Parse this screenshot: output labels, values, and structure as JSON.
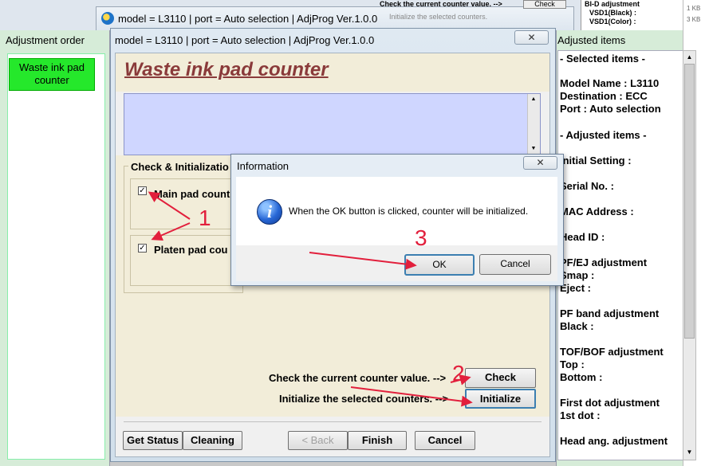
{
  "background": {
    "window_title": "model = L3110 | port = Auto selection | AdjProg Ver.1.0.0",
    "hint_check": "Check the current counter value. -->",
    "hint_init": "Initialize the selected counters.",
    "check_label": "Check",
    "right_panel_lines": [
      "BI-D adjustment",
      "VSD1(Black) :",
      "VSD1(Color) :"
    ],
    "file_sizes": [
      "1 KB",
      "3 KB"
    ]
  },
  "adjustment_order": {
    "title": "Adjustment order",
    "items": [
      {
        "label_line1": "Waste ink pad",
        "label_line2": "counter"
      }
    ]
  },
  "main_window": {
    "title": "model = L3110 | port = Auto selection | AdjProg Ver.1.0.0",
    "close_glyph": "✕",
    "page_title": "Waste ink pad counter",
    "group_label": "Check & Initializatio",
    "main_pad_label": "Main pad count",
    "platen_pad_label": "Platen pad cou",
    "main_pad_checked": true,
    "platen_pad_checked": true,
    "check_hint": "Check the current counter value. -->",
    "check_button": "Check",
    "init_hint": "Initialize the selected counters. -->",
    "init_button": "Initialize",
    "buttons": {
      "get_status": "Get Status",
      "cleaning": "Cleaning",
      "back": "< Back",
      "finish": "Finish",
      "cancel": "Cancel"
    }
  },
  "information_dialog": {
    "title": "Information",
    "close_glyph": "✕",
    "icon": "info-icon",
    "icon_glyph": "i",
    "message": "When the OK button is clicked, counter will be initialized.",
    "ok_label": "OK",
    "cancel_label": "Cancel"
  },
  "adjusted_items": {
    "title": "Adjusted items",
    "lines": [
      "- Selected items -",
      "Model Name : L3110",
      "Destination : ECC",
      "Port : Auto selection",
      "- Adjusted items -",
      "Initial Setting :",
      "Serial No. :",
      "MAC Address :",
      "Head ID :",
      "PF/EJ adjustment",
      " Smap :",
      " Eject :",
      "PF band adjustment",
      " Black :",
      "TOF/BOF adjustment",
      " Top :",
      " Bottom :",
      "First dot adjustment",
      " 1st dot :",
      "Head ang. adjustment"
    ]
  },
  "annotations": {
    "step1": "1",
    "step2": "2",
    "step3": "3",
    "color": "#e21f3c"
  }
}
